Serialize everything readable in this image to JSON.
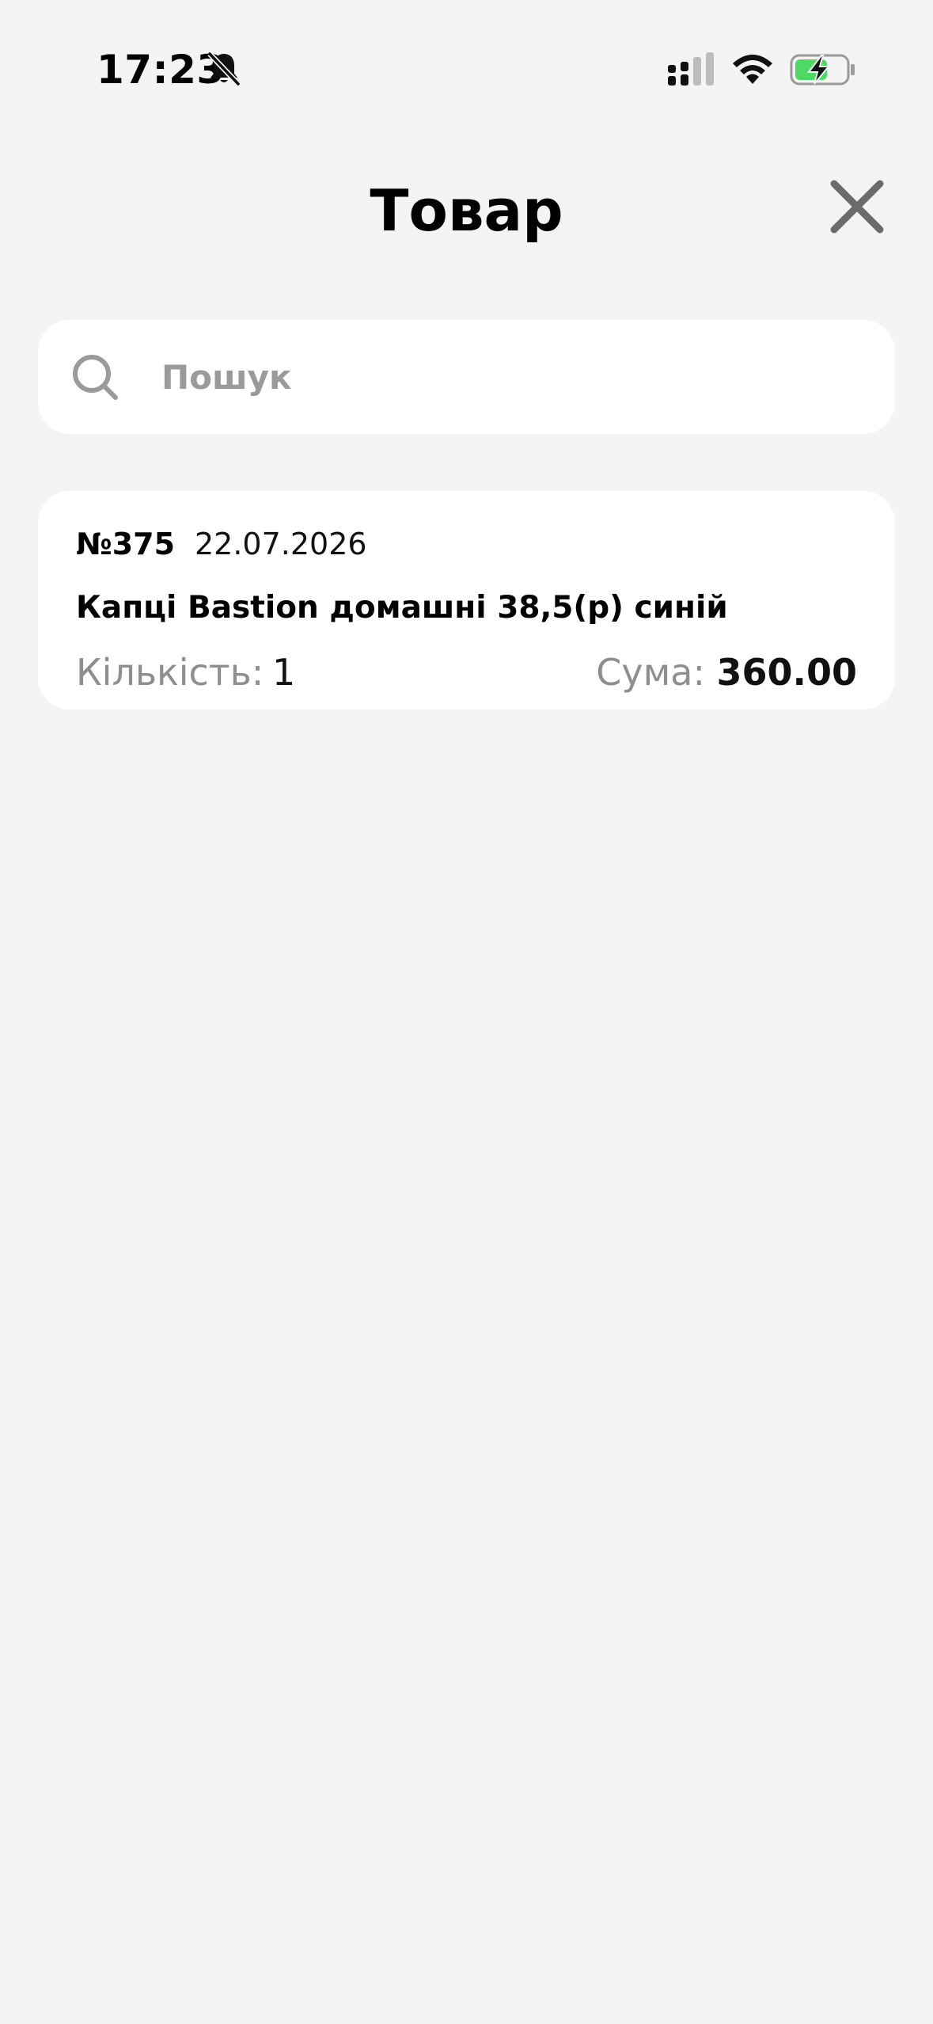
{
  "status_bar": {
    "time": "17:23",
    "icons": [
      "bell-slash-icon",
      "cellular-signal-icon",
      "wifi-icon",
      "battery-charging-icon"
    ],
    "battery_color": "#4cd964"
  },
  "header": {
    "title": "Товар",
    "close_icon": "close-icon"
  },
  "search": {
    "placeholder": "Пошук",
    "value": "",
    "icon": "search-icon"
  },
  "orders": [
    {
      "number": "№375",
      "date": "22.07.2026",
      "product": "Капці Bastion домашні 38,5(р) синій",
      "quantity_label": "Кількість:",
      "quantity": "1",
      "sum_label": "Сума:",
      "sum": "360.00"
    }
  ],
  "colors": {
    "background": "#f4f4f4",
    "card": "#ffffff",
    "muted_text": "#8e8e8e",
    "close_icon": "#6b6b6b"
  }
}
